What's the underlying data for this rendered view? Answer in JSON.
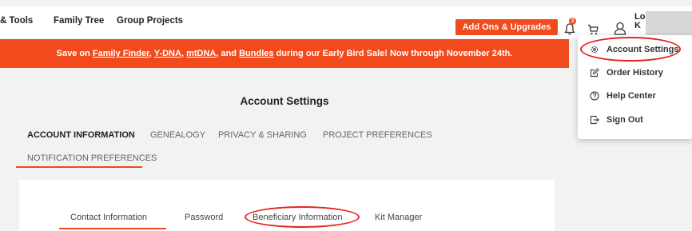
{
  "nav": {
    "items": [
      {
        "label": "& Tools"
      },
      {
        "label": "Family Tree"
      },
      {
        "label": "Group Projects"
      }
    ],
    "addons_label": "Add Ons & Upgrades",
    "notification_count": "3",
    "user_name": "Lo K"
  },
  "promo": {
    "prefix": "Save on ",
    "link1": "Family Finder",
    "sep1": ", ",
    "link2": "Y-DNA",
    "sep2": ", ",
    "link3": "mtDNA",
    "sep3": ", and ",
    "link4": "Bundles",
    "suffix": " during our Early Bird Sale! Now through November 24th."
  },
  "page": {
    "title": "Account Settings"
  },
  "tabs": [
    {
      "label": "ACCOUNT INFORMATION"
    },
    {
      "label": "GENEALOGY"
    },
    {
      "label": "PRIVACY & SHARING"
    },
    {
      "label": "PROJECT PREFERENCES"
    },
    {
      "label": "NOTIFICATION PREFERENCES"
    }
  ],
  "subtabs": [
    {
      "label": "Contact Information"
    },
    {
      "label": "Password"
    },
    {
      "label": "Beneficiary Information"
    },
    {
      "label": "Kit Manager"
    }
  ],
  "user_menu": {
    "items": [
      {
        "label": "Account Settings",
        "icon": "gear-icon"
      },
      {
        "label": "Order History",
        "icon": "edit-icon"
      },
      {
        "label": "Help Center",
        "icon": "help-icon"
      },
      {
        "label": "Sign Out",
        "icon": "sign-out-icon"
      }
    ]
  },
  "colors": {
    "accent": "#f04a1d",
    "annotation": "#e3261f"
  }
}
